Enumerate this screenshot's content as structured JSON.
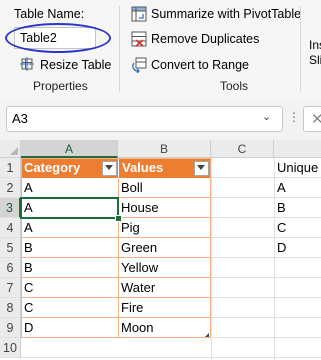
{
  "ribbon": {
    "table_name_label": "Table Name:",
    "table_name_value": "Table2",
    "resize_table": "Resize Table",
    "properties_group": "Properties",
    "summarize_pivot": "Summarize with PivotTable",
    "remove_duplicates": "Remove Duplicates",
    "convert_to_range": "Convert to Range",
    "tools_group": "Tools",
    "insert_slicer_partial_1": "Ins",
    "insert_slicer_partial_2": "Sli"
  },
  "name_box": {
    "value": "A3"
  },
  "grid": {
    "columns": [
      "A",
      "B",
      "C"
    ],
    "rows": [
      "1",
      "2",
      "3",
      "4",
      "5",
      "6",
      "7",
      "8",
      "9",
      "10"
    ],
    "table_headers": [
      "Category",
      "Values"
    ],
    "table_rows": [
      [
        "A",
        "Boll"
      ],
      [
        "A",
        "House"
      ],
      [
        "A",
        "Pig"
      ],
      [
        "B",
        "Green"
      ],
      [
        "B",
        "Yellow"
      ],
      [
        "C",
        "Water"
      ],
      [
        "C",
        "Fire"
      ],
      [
        "D",
        "Moon"
      ]
    ],
    "unique_header": "Unique",
    "unique_values": [
      "A",
      "B",
      "C",
      "D"
    ]
  },
  "colors": {
    "table_header": "#ed7d31",
    "table_border": "#f4b183",
    "selection": "#1b6e3a",
    "highlight_oval": "#2b35c9"
  }
}
